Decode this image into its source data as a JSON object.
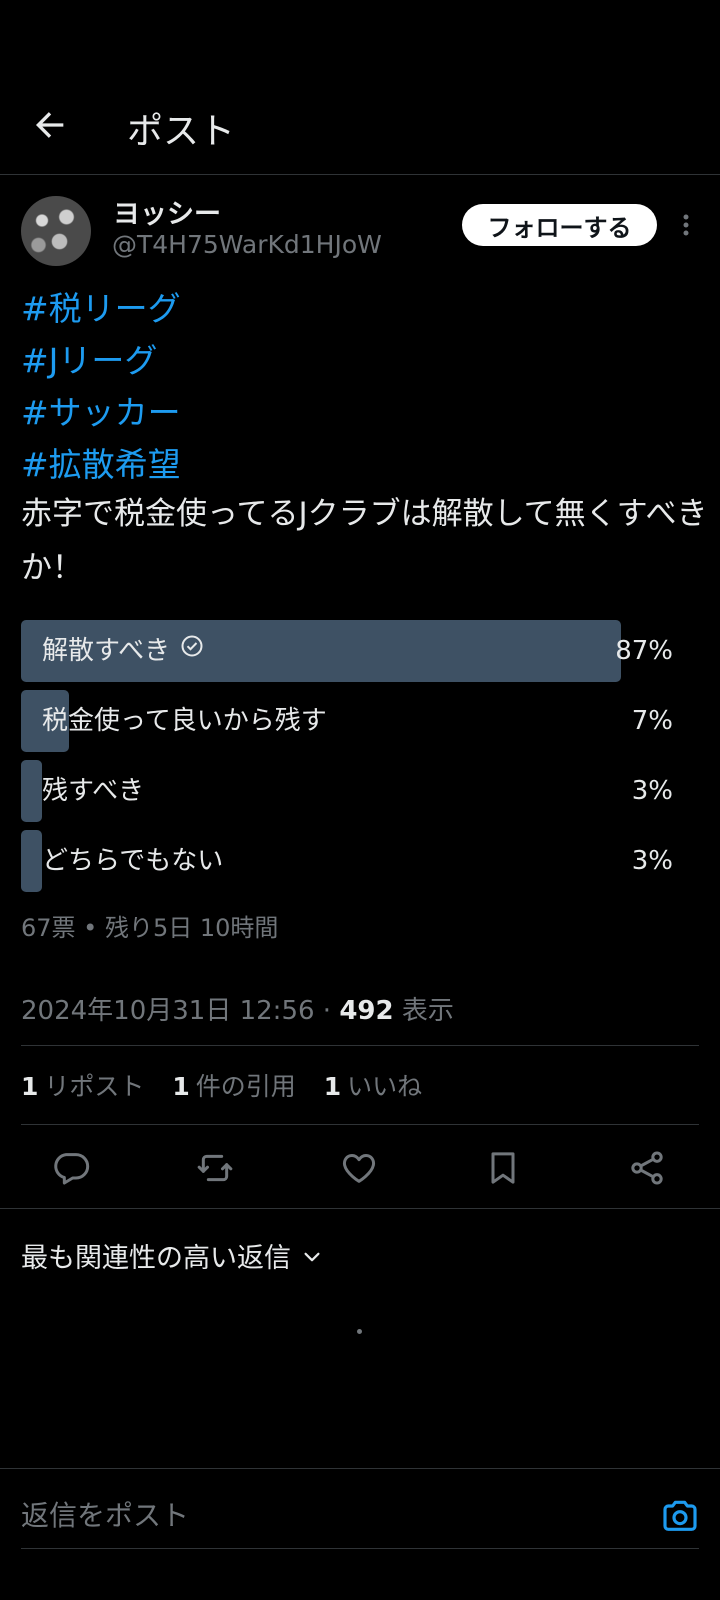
{
  "header": {
    "title": "ポスト"
  },
  "author": {
    "name": "ヨッシー",
    "handle": "@T4H75WarKd1HJoW"
  },
  "follow_button": "フォローする",
  "post": {
    "hashtags": [
      "#税リーグ",
      "#Jリーグ",
      "#サッカー",
      "#拡散希望"
    ],
    "text": "赤字で税金使ってるJクラブは解散して無くすべきか！"
  },
  "poll": {
    "options": [
      {
        "label": "解散すべき",
        "percent": 87,
        "percent_label": "87%",
        "selected": true
      },
      {
        "label": "税金使って良いから残す",
        "percent": 7,
        "percent_label": "7%",
        "selected": false
      },
      {
        "label": "残すべき",
        "percent": 3,
        "percent_label": "3%",
        "selected": false
      },
      {
        "label": "どちらでもない",
        "percent": 3,
        "percent_label": "3%",
        "selected": false
      }
    ],
    "summary": "67票 • 残り5日 10時間"
  },
  "meta": {
    "timestamp": "2024年10月31日 12:56",
    "separator": "·",
    "views_count": "492",
    "views_label": "表示"
  },
  "stats": {
    "reposts_count": "1",
    "reposts_label": "リポスト",
    "quotes_count": "1",
    "quotes_label": "件の引用",
    "likes_count": "1",
    "likes_label": "いいね"
  },
  "actions": [
    "reply-icon",
    "repost-icon",
    "like-icon",
    "bookmark-icon",
    "share-icon"
  ],
  "replies_sort": {
    "label": "最も関連性の高い返信"
  },
  "reply_box": {
    "placeholder": "返信をポスト"
  },
  "colors": {
    "accent": "#1d9bf0",
    "poll_bar": "#3e5164",
    "muted": "#71767b",
    "background": "#000000"
  }
}
